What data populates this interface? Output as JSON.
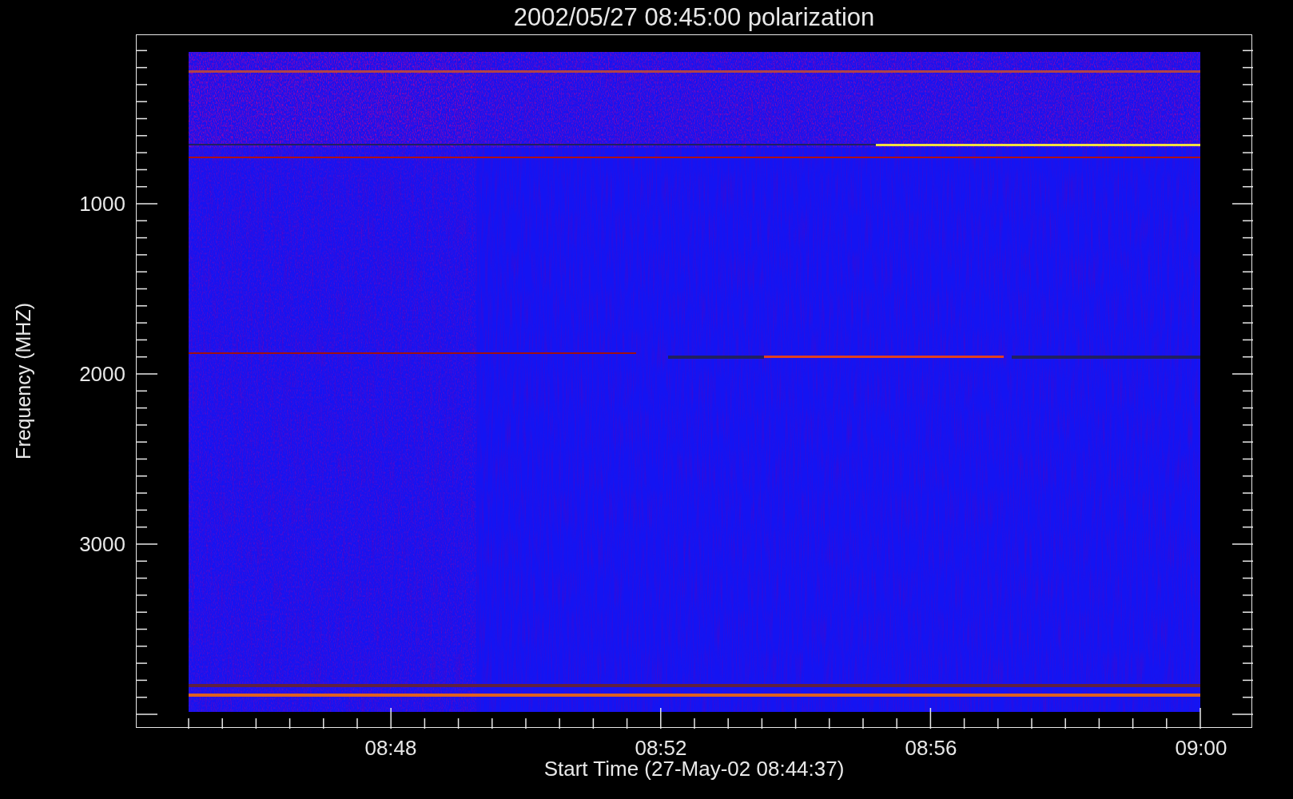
{
  "title": "2002/05/27 08:45:00 polarization",
  "ylabel": "Frequency (MHZ)",
  "yticks": [
    {
      "label": "1000"
    },
    {
      "label": "2000"
    },
    {
      "label": "3000"
    }
  ],
  "xticks": [
    {
      "label": "08:48"
    },
    {
      "label": "08:52"
    },
    {
      "label": "08:56"
    },
    {
      "label": "09:00"
    }
  ],
  "xlabel": "Start Time (27-May-02 08:44:37)"
}
